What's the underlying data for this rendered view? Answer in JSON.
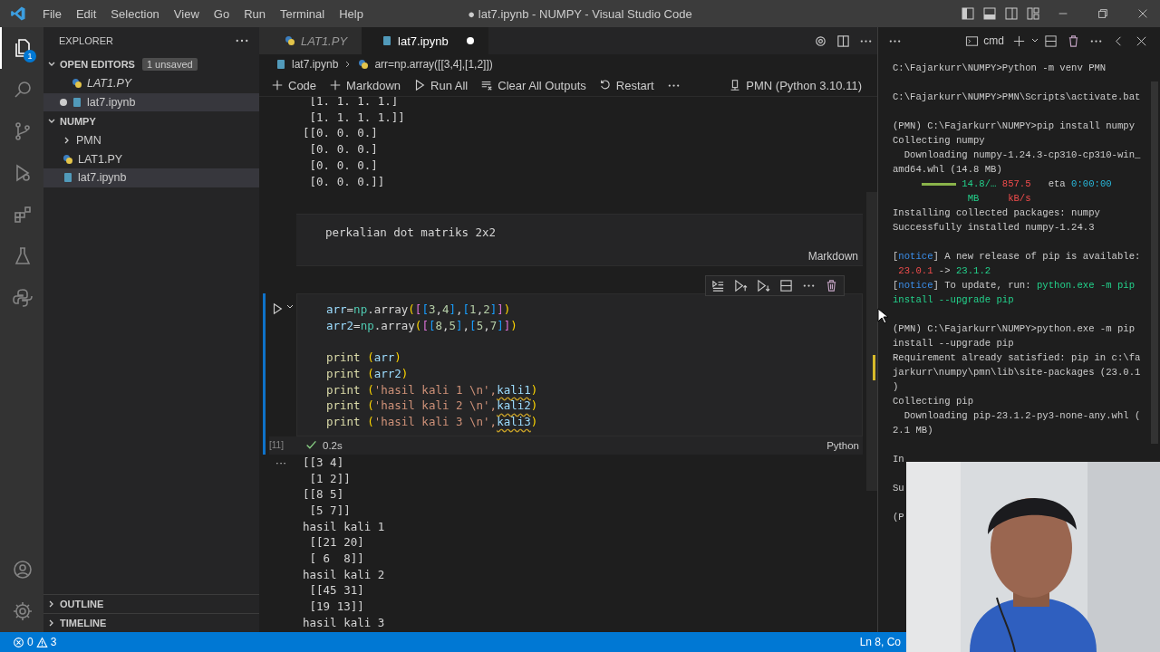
{
  "title_bar": {
    "menu": [
      "File",
      "Edit",
      "Selection",
      "View",
      "Go",
      "Run",
      "Terminal",
      "Help"
    ],
    "title": "● lat7.ipynb - NUMPY - Visual Studio Code"
  },
  "activity_bar": {
    "items": [
      {
        "kind": "explorer",
        "selected": true,
        "badge": "1"
      },
      {
        "kind": "search",
        "selected": false
      },
      {
        "kind": "scm",
        "selected": false
      },
      {
        "kind": "debug",
        "selected": false
      },
      {
        "kind": "extensions",
        "selected": false
      },
      {
        "kind": "testing",
        "selected": false
      },
      {
        "kind": "python",
        "selected": false
      }
    ],
    "bottom": [
      {
        "kind": "account"
      },
      {
        "kind": "settings"
      }
    ]
  },
  "sidebar": {
    "title": "EXPLORER",
    "sections": [
      {
        "title": "OPEN EDITORS",
        "badge": "1 unsaved",
        "expanded": true,
        "items": [
          {
            "name": "LAT1.PY",
            "kind": "python",
            "preview": true,
            "dirty": false,
            "selected": false
          },
          {
            "name": "lat7.ipynb",
            "kind": "notebook",
            "preview": false,
            "dirty": true,
            "selected": true
          }
        ]
      },
      {
        "title": "NUMPY",
        "expanded": true,
        "items": [
          {
            "name": "PMN",
            "kind": "folder",
            "preview": false,
            "dirty": false,
            "selected": false
          },
          {
            "name": "LAT1.PY",
            "kind": "python",
            "preview": false,
            "dirty": false,
            "selected": false
          },
          {
            "name": "lat7.ipynb",
            "kind": "notebook",
            "preview": false,
            "dirty": false,
            "selected": true
          }
        ]
      }
    ],
    "footer": [
      {
        "title": "OUTLINE",
        "expanded": false
      },
      {
        "title": "TIMELINE",
        "expanded": false
      }
    ]
  },
  "editor": {
    "tabs": [
      {
        "label": "LAT1.PY",
        "kind": "python",
        "preview": true,
        "dirty": false,
        "selected": false
      },
      {
        "label": "lat7.ipynb",
        "kind": "notebook",
        "preview": false,
        "dirty": true,
        "selected": true
      }
    ],
    "breadcrumb": [
      {
        "text": "lat7.ipynb",
        "kind": "notebook"
      },
      {
        "text": "arr=np.array([[3,4],[1,2]])",
        "kind": "python"
      }
    ],
    "toolbar": [
      {
        "label": "Code",
        "kind": "add"
      },
      {
        "label": "Markdown",
        "kind": "add"
      },
      {
        "label": "Run All",
        "kind": "run"
      },
      {
        "label": "Clear All Outputs",
        "kind": "clear"
      },
      {
        "label": "Restart",
        "kind": "restart"
      }
    ],
    "kernel": "PMN (Python 3.10.11)",
    "cells": [
      {
        "kind": "output",
        "lines": [
          " [1. 1. 1. 1.]",
          " [1. 1. 1. 1.]]",
          "[[0. 0. 0.]",
          " [0. 0. 0.]",
          " [0. 0. 0.]",
          " [0. 0. 0.]]"
        ]
      },
      {
        "kind": "markdown",
        "text": "perkalian dot matriks 2x2",
        "language": "Markdown"
      },
      {
        "kind": "code",
        "count": "[11]",
        "duration": "0.2s",
        "language": "Python",
        "focused": true,
        "blocks": [
          {
            "lines": [
              [
                {
                  "text": "arr",
                  "kind": "var"
                },
                {
                  "text": "=",
                  "kind": "p"
                },
                {
                  "text": "np",
                  "kind": "cls"
                },
                {
                  "text": ".array",
                  "kind": "p"
                },
                {
                  "text": "(",
                  "kind": "b1"
                },
                {
                  "text": "[",
                  "kind": "b2"
                },
                {
                  "text": "[",
                  "kind": "b3"
                },
                {
                  "text": "3",
                  "kind": "num"
                },
                {
                  "text": ",",
                  "kind": "p"
                },
                {
                  "text": "4",
                  "kind": "num"
                },
                {
                  "text": "]",
                  "kind": "b3"
                },
                {
                  "text": ",",
                  "kind": "p"
                },
                {
                  "text": "[",
                  "kind": "b3"
                },
                {
                  "text": "1",
                  "kind": "num"
                },
                {
                  "text": ",",
                  "kind": "p"
                },
                {
                  "text": "2",
                  "kind": "num"
                },
                {
                  "text": "]",
                  "kind": "b3"
                },
                {
                  "text": "]",
                  "kind": "b2"
                },
                {
                  "text": ")",
                  "kind": "b1"
                }
              ],
              [
                {
                  "text": "arr2",
                  "kind": "var"
                },
                {
                  "text": "=",
                  "kind": "p"
                },
                {
                  "text": "np",
                  "kind": "cls"
                },
                {
                  "text": ".array",
                  "kind": "p"
                },
                {
                  "text": "(",
                  "kind": "b1"
                },
                {
                  "text": "[",
                  "kind": "b2"
                },
                {
                  "text": "[",
                  "kind": "b3"
                },
                {
                  "text": "8",
                  "kind": "num"
                },
                {
                  "text": ",",
                  "kind": "p"
                },
                {
                  "text": "5",
                  "kind": "num"
                },
                {
                  "text": "]",
                  "kind": "b3"
                },
                {
                  "text": ",",
                  "kind": "p"
                },
                {
                  "text": "[",
                  "kind": "b3"
                },
                {
                  "text": "5",
                  "kind": "num"
                },
                {
                  "text": ",",
                  "kind": "p"
                },
                {
                  "text": "7",
                  "kind": "num"
                },
                {
                  "text": "]",
                  "kind": "b3"
                },
                {
                  "text": "]",
                  "kind": "b2"
                },
                {
                  "text": ")",
                  "kind": "b1"
                }
              ]
            ]
          },
          {
            "lines": [
              [
                {
                  "text": "print ",
                  "kind": "fn"
                },
                {
                  "text": "(",
                  "kind": "b1"
                },
                {
                  "text": "arr",
                  "kind": "var"
                },
                {
                  "text": ")",
                  "kind": "b1"
                }
              ],
              [
                {
                  "text": "print ",
                  "kind": "fn"
                },
                {
                  "text": "(",
                  "kind": "b1"
                },
                {
                  "text": "arr2",
                  "kind": "var"
                },
                {
                  "text": ")",
                  "kind": "b1"
                }
              ],
              [
                {
                  "text": "print ",
                  "kind": "fn"
                },
                {
                  "text": "(",
                  "kind": "b1"
                },
                {
                  "text": "'hasil kali 1 \\n',",
                  "kind": "str"
                },
                {
                  "text": "kali1",
                  "kind": "warn"
                },
                {
                  "text": ")",
                  "kind": "b1"
                }
              ],
              [
                {
                  "text": "print ",
                  "kind": "fn"
                },
                {
                  "text": "(",
                  "kind": "b1"
                },
                {
                  "text": "'hasil kali 2 \\n',",
                  "kind": "str"
                },
                {
                  "text": "kali2",
                  "kind": "warn"
                },
                {
                  "text": ")",
                  "kind": "b1"
                }
              ],
              [
                {
                  "text": "print ",
                  "kind": "fn"
                },
                {
                  "text": "(",
                  "kind": "b1"
                },
                {
                  "text": "'hasil kali 3 \\n',",
                  "kind": "str"
                },
                {
                  "text": "kali3",
                  "kind": "warn"
                },
                {
                  "text": ")",
                  "kind": "b1"
                }
              ]
            ]
          }
        ]
      },
      {
        "kind": "output",
        "marker": "···",
        "lines": [
          "[[3 4]",
          " [1 2]]",
          "[[8 5]",
          " [5 7]]",
          "hasil kali 1",
          " [[21 20]",
          " [ 6  8]]",
          "hasil kali 2",
          " [[45 31]",
          " [19 13]]",
          "hasil kali 3"
        ]
      }
    ]
  },
  "terminal": {
    "profile": "cmd",
    "blocks": [
      {
        "lines": [
          [
            {
              "text": "C:\\Fajarkurr\\NUMPY>Python -m venv PMN",
              "kind": "p"
            }
          ]
        ]
      },
      {
        "lines": [
          [
            {
              "text": "C:\\Fajarkurr\\NUMPY>PMN\\Scripts\\activate.bat",
              "kind": "p"
            }
          ]
        ]
      },
      {
        "lines": [
          [
            {
              "text": "(PMN) C:\\Fajarkurr\\NUMPY>pip install numpy",
              "kind": "p"
            }
          ],
          [
            {
              "text": "Collecting numpy",
              "kind": "p"
            }
          ],
          [
            {
              "text": "  Downloading numpy-1.24.3-cp310-cp310-win_",
              "kind": "p"
            }
          ],
          [
            {
              "text": "amd64.whl (14.8 MB)",
              "kind": "p"
            }
          ],
          [
            {
              "kind": "bar",
              "level": 1
            },
            {
              "text": "14.8/… ",
              "kind": "green"
            },
            {
              "text": "857.5",
              "kind": "red"
            },
            {
              "text": "   eta ",
              "kind": "p"
            },
            {
              "text": "0:00:00",
              "kind": "cyan"
            }
          ],
          [
            {
              "text": "             MB",
              "kind": "green"
            },
            {
              "text": "     kB/s",
              "kind": "red"
            }
          ],
          [
            {
              "text": "Installing collected packages: numpy",
              "kind": "p"
            }
          ],
          [
            {
              "text": "Successfully installed numpy-1.24.3",
              "kind": "p"
            }
          ]
        ]
      },
      {
        "lines": [
          [
            {
              "text": "[",
              "kind": "p"
            },
            {
              "text": "notice",
              "kind": "blue"
            },
            {
              "text": "] A new release of pip is available:",
              "kind": "p"
            }
          ],
          [
            {
              "text": " 23.0.1",
              "kind": "red"
            },
            {
              "text": " -> ",
              "kind": "p"
            },
            {
              "text": "23.1.2",
              "kind": "green"
            }
          ],
          [
            {
              "text": "[",
              "kind": "p"
            },
            {
              "text": "notice",
              "kind": "blue"
            },
            {
              "text": "] To update, run: ",
              "kind": "p"
            },
            {
              "text": "python.exe -m pip",
              "kind": "green"
            }
          ],
          [
            {
              "text": "install --upgrade pip",
              "kind": "green"
            }
          ]
        ]
      },
      {
        "lines": [
          [
            {
              "text": "(PMN) C:\\Fajarkurr\\NUMPY>python.exe -m pip",
              "kind": "p"
            }
          ],
          [
            {
              "text": "install --upgrade pip",
              "kind": "p"
            }
          ],
          [
            {
              "text": "Requirement already satisfied: pip in c:\\fa",
              "kind": "p"
            }
          ],
          [
            {
              "text": "jarkurr\\numpy\\pmn\\lib\\site-packages (23.0.1",
              "kind": "p"
            }
          ],
          [
            {
              "text": ")",
              "kind": "p"
            }
          ],
          [
            {
              "text": "Collecting pip",
              "kind": "p"
            }
          ],
          [
            {
              "text": "  Downloading pip-23.1.2-py3-none-any.whl (",
              "kind": "p"
            }
          ],
          [
            {
              "text": "2.1 MB)",
              "kind": "p"
            }
          ]
        ]
      },
      {
        "lines": [
          [
            {
              "text": "In",
              "kind": "p"
            }
          ]
        ]
      },
      {
        "lines": [
          [
            {
              "text": "Su",
              "kind": "p"
            }
          ]
        ]
      },
      {
        "lines": [
          [
            {
              "text": "(P",
              "kind": "p"
            }
          ]
        ]
      }
    ]
  },
  "status_bar": {
    "errors": "0",
    "warnings": "3",
    "position": "Ln 8, Co"
  }
}
